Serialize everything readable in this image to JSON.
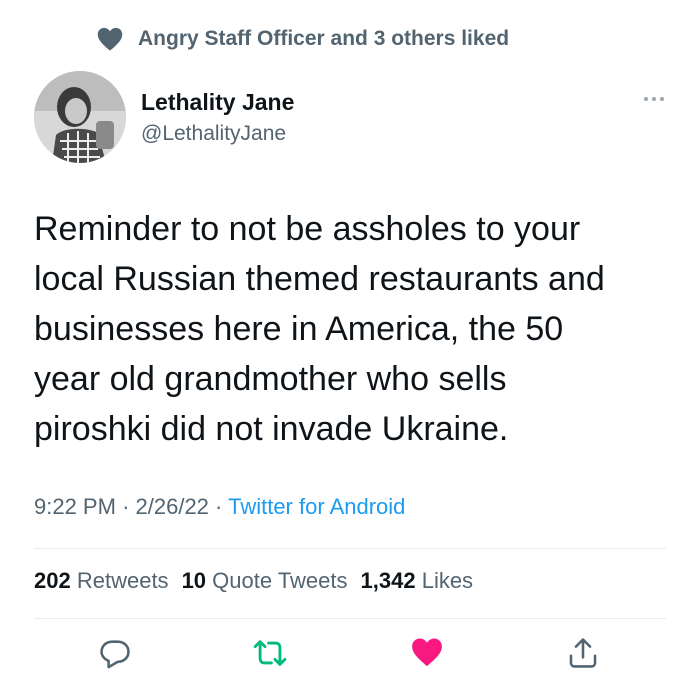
{
  "social_context": {
    "text": "Angry Staff Officer and 3 others liked",
    "icon": "heart-icon"
  },
  "author": {
    "display_name": "Lethality Jane",
    "handle": "@LethalityJane"
  },
  "tweet": {
    "text": "Reminder to not be assholes to your\nlocal Russian themed restaurants and\nbusinesses here in America, the 50\nyear old grandmother who sells\npiroshki did not invade Ukraine.",
    "time": "9:22 PM",
    "date": "2/26/22",
    "source": "Twitter for Android"
  },
  "stats": {
    "retweets_count": "202",
    "retweets_label": "Retweets",
    "quotes_count": "10",
    "quotes_label": "Quote Tweets",
    "likes_count": "1,342",
    "likes_label": "Likes"
  },
  "actions": {
    "reply_icon": "reply-icon",
    "retweet_icon": "retweet-icon",
    "like_icon": "heart-icon",
    "share_icon": "share-icon"
  },
  "colors": {
    "text": "#0f1419",
    "secondary": "#536471",
    "link": "#1d9bf0",
    "retweet": "#00ba7c",
    "like": "#f91880"
  }
}
